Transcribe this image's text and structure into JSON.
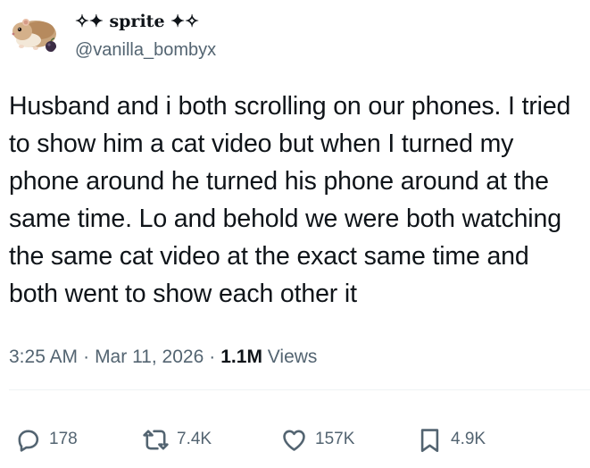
{
  "author": {
    "display_name": "✧✦ sprite ✦✧",
    "handle": "@vanilla_bombyx"
  },
  "tweet": {
    "text": "Husband and i both scrolling on our phones. I tried to show him a cat video but when I turned my phone around he turned his phone around at the same time. Lo and behold we were both watching the same cat video at the exact same time and both went to show each other it",
    "time": "3:25 AM",
    "date": "Mar 11, 2026",
    "views_count": "1.1M",
    "views_label": "Views",
    "separator": "·"
  },
  "actions": {
    "replies": "178",
    "reposts": "7.4K",
    "likes": "157K",
    "bookmarks": "4.9K"
  },
  "icons": {
    "reply": "reply-icon",
    "repost": "repost-icon",
    "like": "heart-icon",
    "bookmark": "bookmark-icon"
  },
  "colors": {
    "text_primary": "#0f1419",
    "text_secondary": "#536471",
    "divider": "#eff3f4"
  }
}
